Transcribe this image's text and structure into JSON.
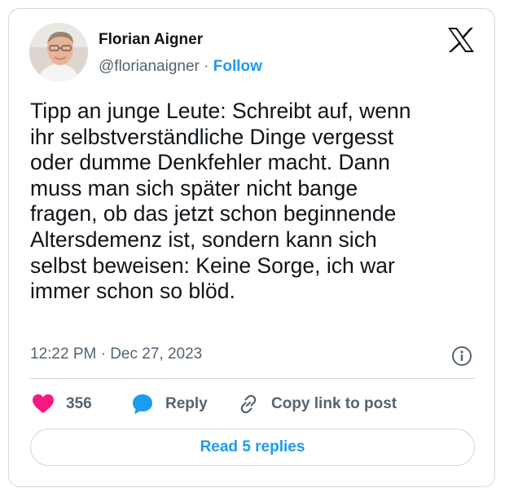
{
  "author": {
    "name": "Florian Aigner",
    "handle": "@florianaigner",
    "separator": "·",
    "follow_label": "Follow"
  },
  "tweet": {
    "text": "Tipp an junge Leute: Schreibt auf, wenn\nihr selbstverständliche Dinge vergesst\noder dumme Denkfehler macht. Dann\nmuss man sich später nicht bange\nfragen, ob das jetzt schon beginnende\nAltersdemenz ist, sondern kann sich\nselbst beweisen: Keine Sorge, ich war\nimmer schon so blöd.",
    "timestamp": "12:22 PM · Dec 27, 2023"
  },
  "actions": {
    "likes_count": "356",
    "reply_label": "Reply",
    "copy_link_label": "Copy link to post"
  },
  "read_replies_label": "Read 5 replies",
  "icons": {
    "platform": "x-logo-icon",
    "info": "info-icon",
    "like": "heart-icon",
    "reply": "speech-bubble-icon",
    "copy_link": "link-icon"
  },
  "colors": {
    "accent": "#1d9bf0",
    "heart": "#f91880",
    "text": "#0f1419",
    "muted": "#536471",
    "border": "#cfd9de"
  }
}
